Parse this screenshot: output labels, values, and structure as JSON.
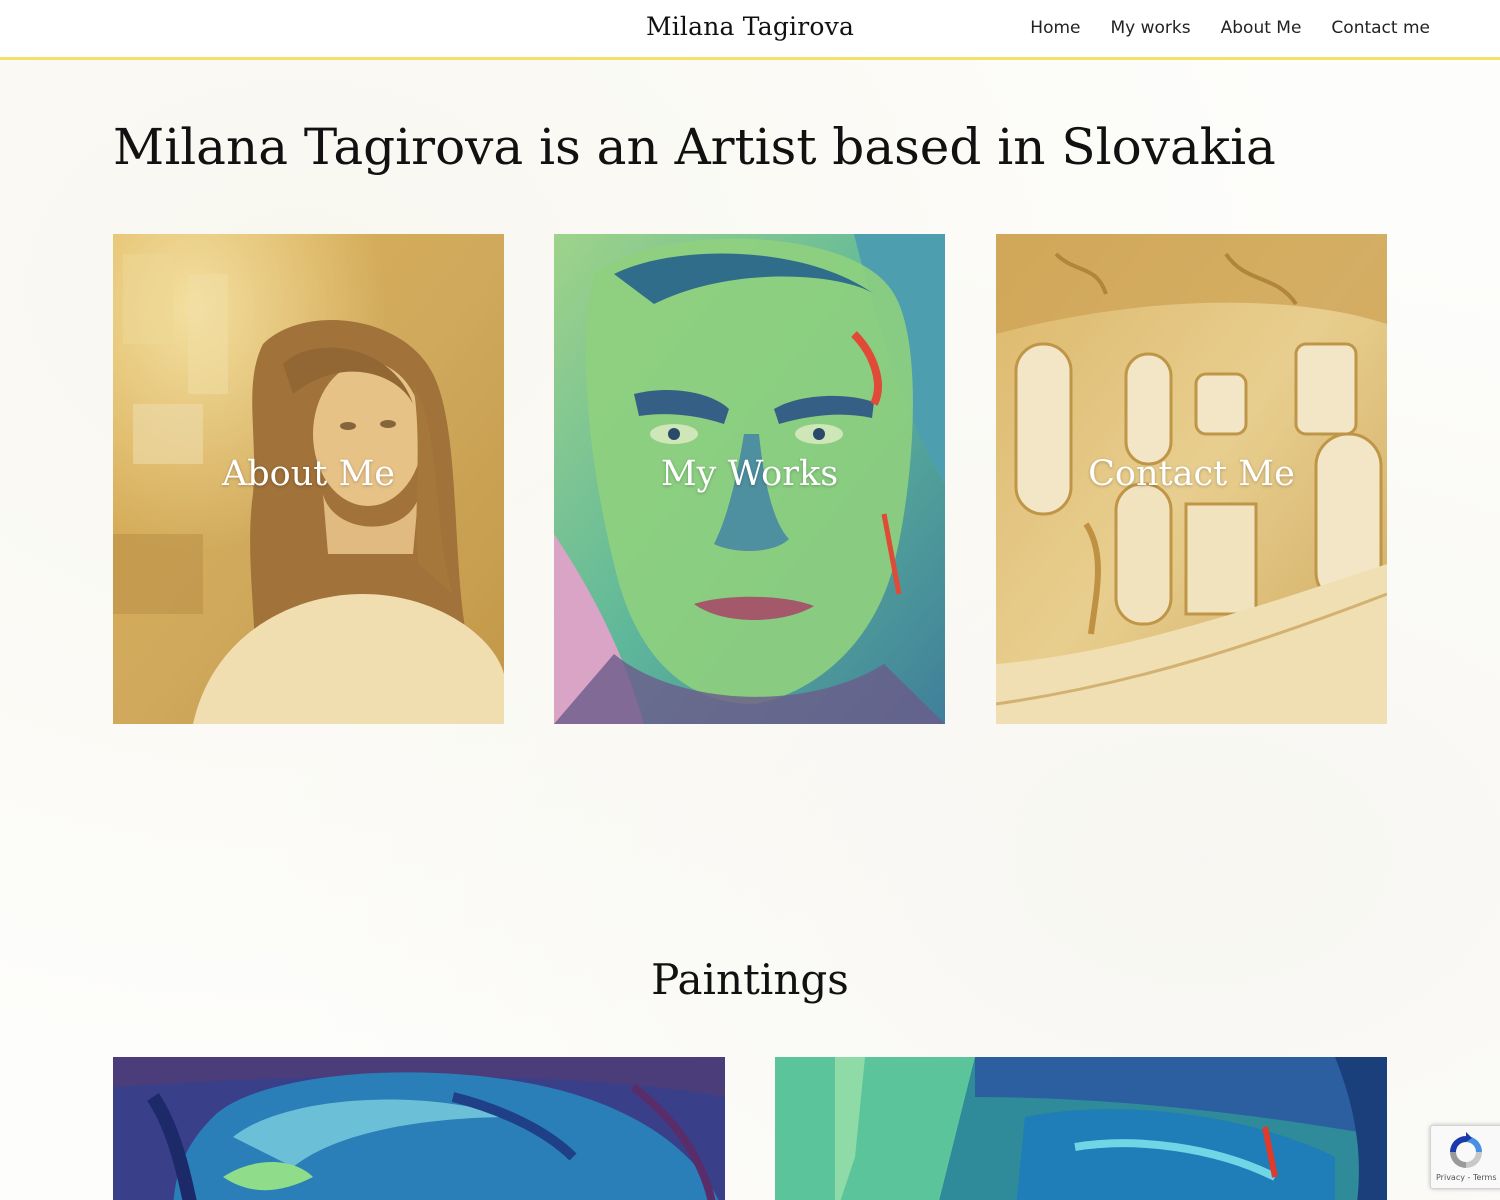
{
  "header": {
    "site_title": "Milana Tagirova",
    "nav": [
      "Home",
      "My works",
      "About Me",
      "Contact me"
    ]
  },
  "hero": {
    "heading": "Milana Tagirova is an Artist based in Slovakia"
  },
  "tiles": [
    {
      "label": "About Me"
    },
    {
      "label": "My Works"
    },
    {
      "label": "Contact Me"
    }
  ],
  "paintings_section": {
    "heading": "Paintings"
  },
  "recaptcha": {
    "privacy": "Privacy",
    "separator": " - ",
    "terms": "Terms"
  },
  "colors": {
    "header_border": "#f5e06a",
    "tile_overlay": "#e8c76a"
  }
}
